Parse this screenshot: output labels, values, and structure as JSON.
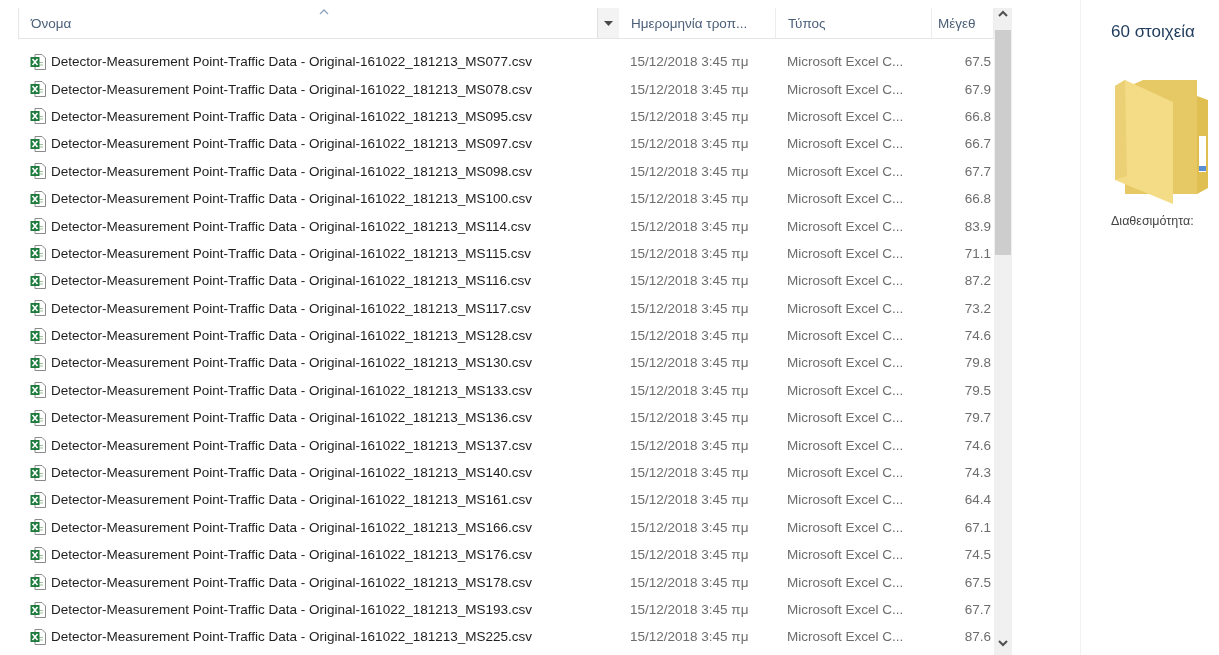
{
  "columns": [
    {
      "label": "Όνομα",
      "sorted": true,
      "filter": true
    },
    {
      "label": "Ημερομηνία τροπ...",
      "sorted": false,
      "filter": false
    },
    {
      "label": "Τύπος",
      "sorted": false,
      "filter": false
    },
    {
      "label": "Μέγεθ",
      "sorted": false,
      "filter": false
    }
  ],
  "rows": [
    {
      "name": "Detector-Measurement Point-Traffic Data - Original-161022_181213_MS077.csv",
      "modified": "15/12/2018 3:45 πμ",
      "type": "Microsoft Excel C...",
      "size": "67.5"
    },
    {
      "name": "Detector-Measurement Point-Traffic Data - Original-161022_181213_MS078.csv",
      "modified": "15/12/2018 3:45 πμ",
      "type": "Microsoft Excel C...",
      "size": "67.9"
    },
    {
      "name": "Detector-Measurement Point-Traffic Data - Original-161022_181213_MS095.csv",
      "modified": "15/12/2018 3:45 πμ",
      "type": "Microsoft Excel C...",
      "size": "66.8"
    },
    {
      "name": "Detector-Measurement Point-Traffic Data - Original-161022_181213_MS097.csv",
      "modified": "15/12/2018 3:45 πμ",
      "type": "Microsoft Excel C...",
      "size": "66.7"
    },
    {
      "name": "Detector-Measurement Point-Traffic Data - Original-161022_181213_MS098.csv",
      "modified": "15/12/2018 3:45 πμ",
      "type": "Microsoft Excel C...",
      "size": "67.7"
    },
    {
      "name": "Detector-Measurement Point-Traffic Data - Original-161022_181213_MS100.csv",
      "modified": "15/12/2018 3:45 πμ",
      "type": "Microsoft Excel C...",
      "size": "66.8"
    },
    {
      "name": "Detector-Measurement Point-Traffic Data - Original-161022_181213_MS114.csv",
      "modified": "15/12/2018 3:45 πμ",
      "type": "Microsoft Excel C...",
      "size": "83.9"
    },
    {
      "name": "Detector-Measurement Point-Traffic Data - Original-161022_181213_MS115.csv",
      "modified": "15/12/2018 3:45 πμ",
      "type": "Microsoft Excel C...",
      "size": "71.1"
    },
    {
      "name": "Detector-Measurement Point-Traffic Data - Original-161022_181213_MS116.csv",
      "modified": "15/12/2018 3:45 πμ",
      "type": "Microsoft Excel C...",
      "size": "87.2"
    },
    {
      "name": "Detector-Measurement Point-Traffic Data - Original-161022_181213_MS117.csv",
      "modified": "15/12/2018 3:45 πμ",
      "type": "Microsoft Excel C...",
      "size": "73.2"
    },
    {
      "name": "Detector-Measurement Point-Traffic Data - Original-161022_181213_MS128.csv",
      "modified": "15/12/2018 3:45 πμ",
      "type": "Microsoft Excel C...",
      "size": "74.6"
    },
    {
      "name": "Detector-Measurement Point-Traffic Data - Original-161022_181213_MS130.csv",
      "modified": "15/12/2018 3:45 πμ",
      "type": "Microsoft Excel C...",
      "size": "79.8"
    },
    {
      "name": "Detector-Measurement Point-Traffic Data - Original-161022_181213_MS133.csv",
      "modified": "15/12/2018 3:45 πμ",
      "type": "Microsoft Excel C...",
      "size": "79.5"
    },
    {
      "name": "Detector-Measurement Point-Traffic Data - Original-161022_181213_MS136.csv",
      "modified": "15/12/2018 3:45 πμ",
      "type": "Microsoft Excel C...",
      "size": "79.7"
    },
    {
      "name": "Detector-Measurement Point-Traffic Data - Original-161022_181213_MS137.csv",
      "modified": "15/12/2018 3:45 πμ",
      "type": "Microsoft Excel C...",
      "size": "74.6"
    },
    {
      "name": "Detector-Measurement Point-Traffic Data - Original-161022_181213_MS140.csv",
      "modified": "15/12/2018 3:45 πμ",
      "type": "Microsoft Excel C...",
      "size": "74.3"
    },
    {
      "name": "Detector-Measurement Point-Traffic Data - Original-161022_181213_MS161.csv",
      "modified": "15/12/2018 3:45 πμ",
      "type": "Microsoft Excel C...",
      "size": "64.4"
    },
    {
      "name": "Detector-Measurement Point-Traffic Data - Original-161022_181213_MS166.csv",
      "modified": "15/12/2018 3:45 πμ",
      "type": "Microsoft Excel C...",
      "size": "67.1"
    },
    {
      "name": "Detector-Measurement Point-Traffic Data - Original-161022_181213_MS176.csv",
      "modified": "15/12/2018 3:45 πμ",
      "type": "Microsoft Excel C...",
      "size": "74.5"
    },
    {
      "name": "Detector-Measurement Point-Traffic Data - Original-161022_181213_MS178.csv",
      "modified": "15/12/2018 3:45 πμ",
      "type": "Microsoft Excel C...",
      "size": "67.5"
    },
    {
      "name": "Detector-Measurement Point-Traffic Data - Original-161022_181213_MS193.csv",
      "modified": "15/12/2018 3:45 πμ",
      "type": "Microsoft Excel C...",
      "size": "67.7"
    },
    {
      "name": "Detector-Measurement Point-Traffic Data - Original-161022_181213_MS225.csv",
      "modified": "15/12/2018 3:45 πμ",
      "type": "Microsoft Excel C...",
      "size": "87.6"
    }
  ],
  "details": {
    "count": "60 στοιχεία",
    "availability": "Διαθεσιμότητα:"
  }
}
